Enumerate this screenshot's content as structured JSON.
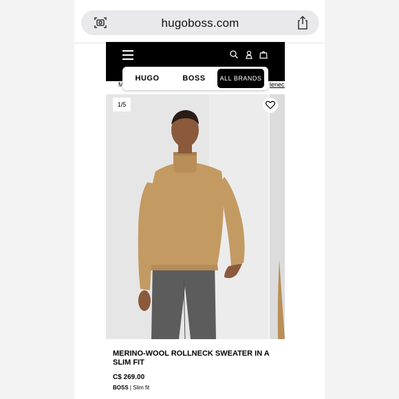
{
  "browser": {
    "url": "hugoboss.com",
    "icons": {
      "lens": "visual-lookup-icon",
      "share": "share-icon"
    }
  },
  "site": {
    "header": {
      "icons": [
        "menu-icon",
        "search-icon",
        "account-icon",
        "bag-icon"
      ],
      "brand_tabs": [
        {
          "label": "HUGO",
          "active": false
        },
        {
          "label": "BOSS",
          "active": false
        },
        {
          "label": "ALL BRANDS",
          "active": true
        }
      ]
    },
    "breadcrumb": {
      "left_fragment": "M",
      "right_fragment": "leneck"
    },
    "product": {
      "image_counter": "1/5",
      "title": "MERINO-WOOL ROLLNECK SWEATER IN A SLIM FIT",
      "price": "C$ 269.00",
      "brand": "BOSS",
      "separator": "|",
      "fit": "Slim fit"
    }
  },
  "colors": {
    "header_bg": "#000000",
    "sweater": "#c49a63",
    "trousers": "#5c5c5c"
  }
}
